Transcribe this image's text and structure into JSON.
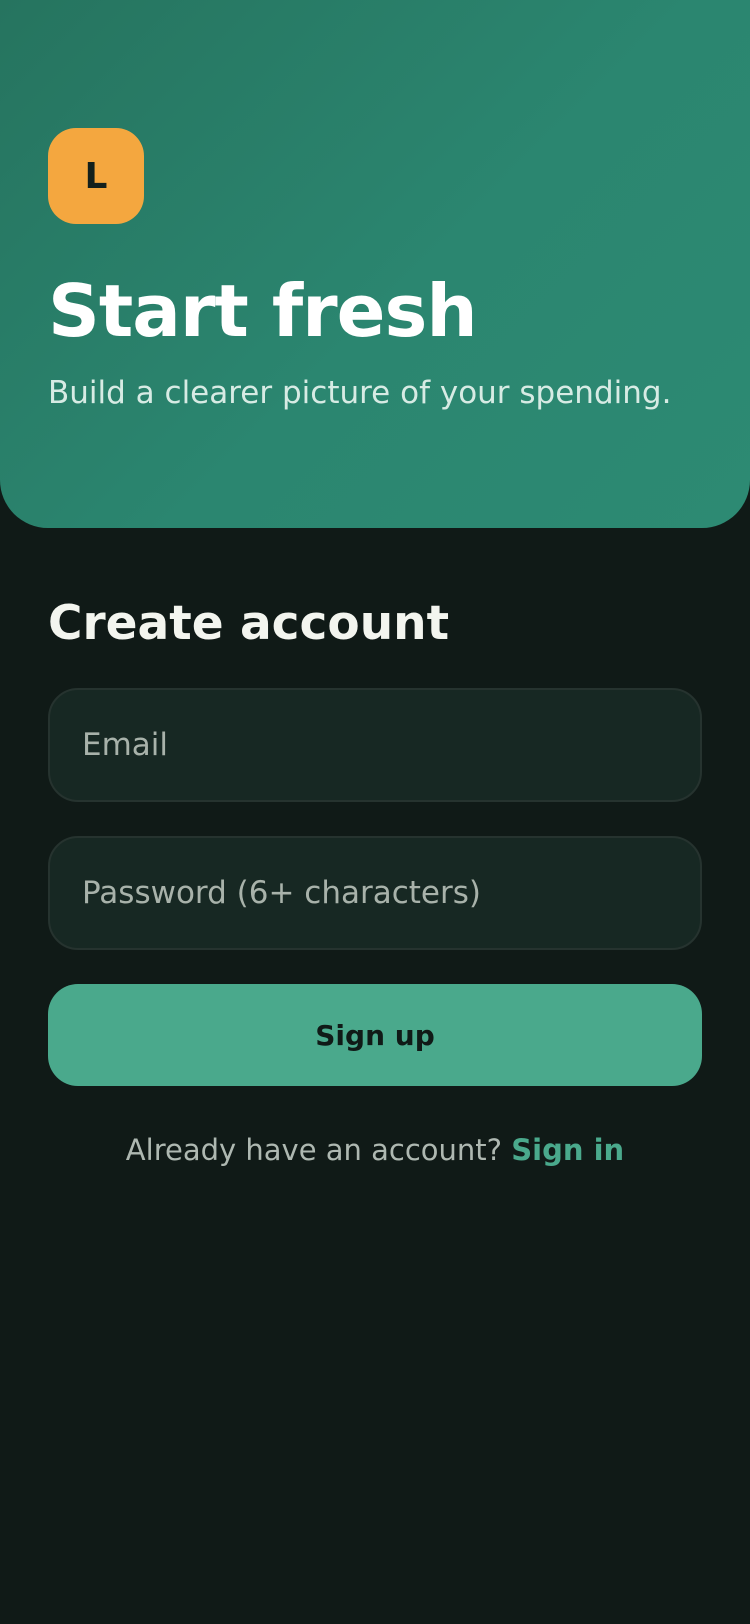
{
  "brand": {
    "logo_letter": "L",
    "logo_color": "#f4a73f"
  },
  "hero": {
    "title": "Start fresh",
    "subtitle": "Build a clearer picture of your spending.",
    "background_color": "#2b8670"
  },
  "form": {
    "title": "Create account",
    "email": {
      "placeholder": "Email",
      "value": ""
    },
    "password": {
      "placeholder": "Password (6+ characters)",
      "value": ""
    },
    "submit_label": "Sign up",
    "accent_color": "#4aa98c"
  },
  "footer": {
    "prompt": "Already have an account?",
    "signin_label": "Sign in"
  },
  "page": {
    "background_color": "#101a17"
  }
}
